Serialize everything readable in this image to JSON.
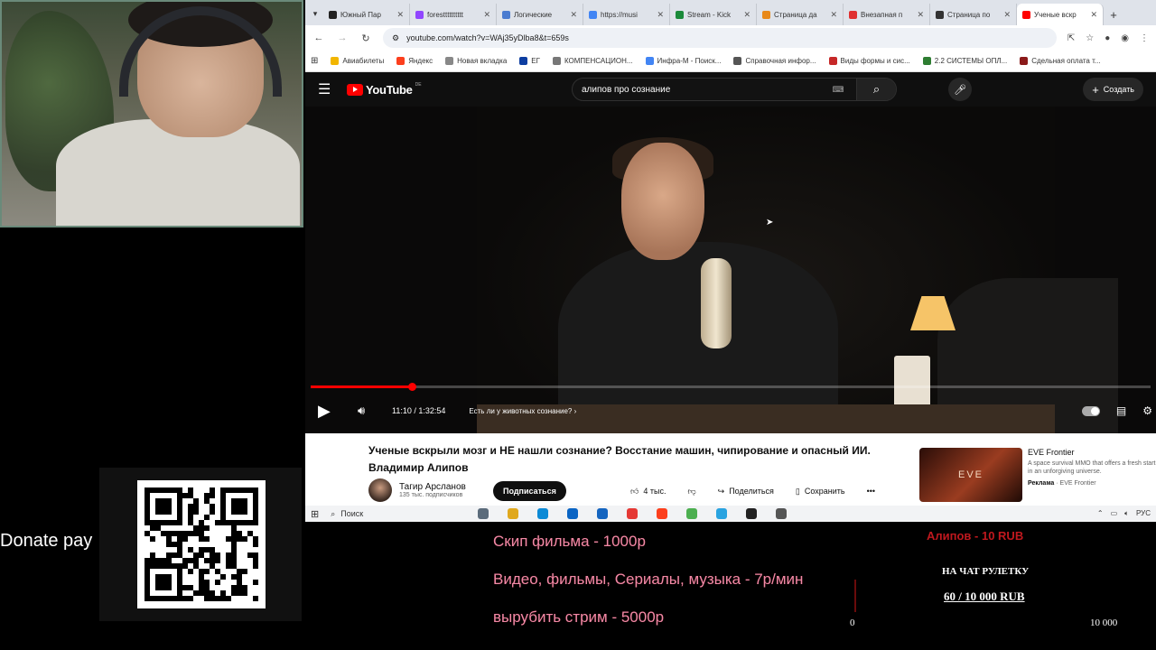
{
  "browser": {
    "tabs": [
      {
        "label": "Южный Пар",
        "color": "#222222"
      },
      {
        "label": "forestttttttttt",
        "color": "#9146ff"
      },
      {
        "label": "Логические",
        "color": "#4a7bd0"
      },
      {
        "label": "https://musi",
        "color": "#4285f4"
      },
      {
        "label": "Stream - Kick",
        "color": "#1b8a3a"
      },
      {
        "label": "Страница да",
        "color": "#e8891a"
      },
      {
        "label": "Внезапная п",
        "color": "#e03030"
      },
      {
        "label": "Страница по",
        "color": "#333333"
      },
      {
        "label": "Ученые вскр",
        "color": "#ff0000"
      }
    ],
    "url": "youtube.com/watch?v=WAj35yDlba8&t=659s",
    "bookmarks": [
      {
        "label": "Авиабилеты",
        "color": "#f2b600"
      },
      {
        "label": "Яндекс",
        "color": "#fc3f1d"
      },
      {
        "label": "Новая вкладка",
        "color": "#888888"
      },
      {
        "label": "ЕГ",
        "color": "#0d3ea1"
      },
      {
        "label": "КОМПЕНСАЦИОН...",
        "color": "#777777"
      },
      {
        "label": "Инфра-М - Поиск...",
        "color": "#4285f4"
      },
      {
        "label": "Справочная инфор...",
        "color": "#555555"
      },
      {
        "label": "Виды формы и сис...",
        "color": "#c62828"
      },
      {
        "label": "2.2 СИСТЕМЫ ОПЛ...",
        "color": "#2e7d32"
      },
      {
        "label": "Сдельная оплата т...",
        "color": "#8b1a1a"
      }
    ]
  },
  "youtube": {
    "logo": "YouTube",
    "region": "DE",
    "search_query": "алипов про сознание",
    "create_label": "Создать",
    "player": {
      "time": "11:10 / 1:32:54",
      "chapter": "Есть ли у животных сознание?",
      "progress": 0.12
    },
    "video_title": "Ученые вскрыли мозг и НЕ нашли сознание? Восстание машин, чипирование и опасный ИИ. Владимир Алипов",
    "channel_name": "Тагир Арсланов",
    "subscribers": "135 тыс. подписчиков",
    "subscribe_label": "Подписаться",
    "likes": "4 тыс.",
    "share_label": "Поделиться",
    "save_label": "Сохранить",
    "ad": {
      "title": "EVE Frontier",
      "description": "A space survival MMO that offers a fresh start in an unforgiving universe.",
      "sponsored": "Реклама",
      "advertiser": "EVE Frontier",
      "thumb_text": "EVE"
    }
  },
  "taskbar": {
    "search": "Поиск",
    "tray_lang": "РУС",
    "apps": [
      "#5b6b7b",
      "#e0a81e",
      "#0c8ad6",
      "#0a64c4",
      "#1565c0",
      "#e53935",
      "#fc3f1d",
      "#4caf50",
      "#2aa3e0",
      "#222222",
      "#555555"
    ]
  },
  "overlay": {
    "donate_label": "Donate pay",
    "prices": [
      "Скип фильма - 1000р",
      "Видео, фильмы, Сериалы, музыка - 7р/мин",
      "вырубить стрим - 5000р"
    ],
    "promo": "Алипов - 10 RUB",
    "roulette_label": "НА ЧАТ РУЛЕТКУ",
    "roulette_value": "60 / 10 000 RUB",
    "goal_min": "0",
    "goal_max": "10 000"
  }
}
